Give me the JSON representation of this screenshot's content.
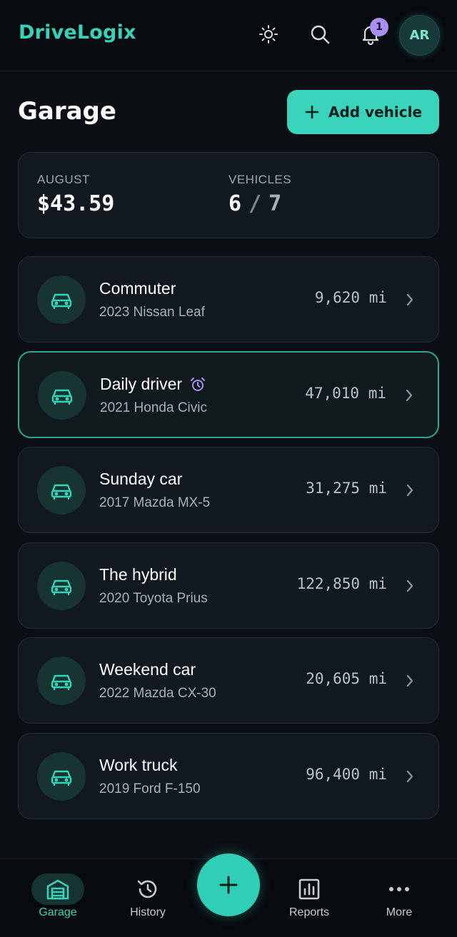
{
  "app": {
    "name": "DriveLogix"
  },
  "header": {
    "notification_count": "1",
    "avatar_initials": "AR"
  },
  "page": {
    "title": "Garage",
    "add_vehicle_label": "Add vehicle"
  },
  "summary": {
    "month_label": "AUGUST",
    "month_value": "$43.59",
    "vehicles_label": "VEHICLES",
    "vehicles_current": "6",
    "vehicles_separator": "/",
    "vehicles_total": "7"
  },
  "vehicles": [
    {
      "name": "Commuter",
      "model": "2023 Nissan Leaf",
      "miles": "9,620 mi",
      "selected": false,
      "reminder": false
    },
    {
      "name": "Daily driver",
      "model": "2021 Honda Civic",
      "miles": "47,010 mi",
      "selected": true,
      "reminder": true
    },
    {
      "name": "Sunday car",
      "model": "2017 Mazda MX-5",
      "miles": "31,275 mi",
      "selected": false,
      "reminder": false
    },
    {
      "name": "The hybrid",
      "model": "2020 Toyota Prius",
      "miles": "122,850 mi",
      "selected": false,
      "reminder": false
    },
    {
      "name": "Weekend car",
      "model": "2022 Mazda CX-30",
      "miles": "20,605 mi",
      "selected": false,
      "reminder": false
    },
    {
      "name": "Work truck",
      "model": "2019 Ford F-150",
      "miles": "96,400 mi",
      "selected": false,
      "reminder": false
    }
  ],
  "nav": {
    "garage": "Garage",
    "history": "History",
    "reports": "Reports",
    "more": "More"
  },
  "icons": {
    "theme": "sun-icon",
    "search": "search-icon",
    "notifications": "bell-icon",
    "vehicle": "car-icon",
    "reminder": "alarm-clock-icon",
    "row_action": "chevron-right-icon",
    "fab": "plus-icon"
  },
  "colors": {
    "accent": "#36d3bb",
    "background": "#0b0f13",
    "card": "#121820",
    "badge": "#a98ff2",
    "reminder": "#a98ff2"
  }
}
